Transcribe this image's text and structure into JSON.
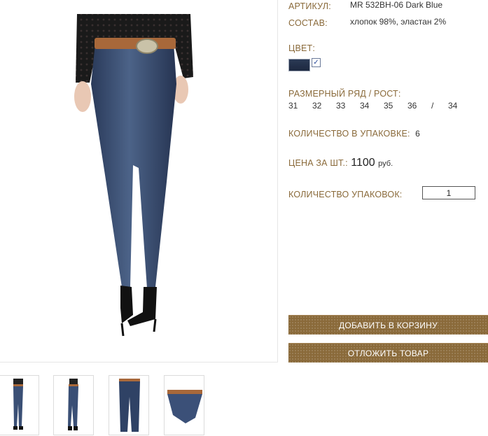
{
  "product": {
    "article_label": "АРТИКУЛ:",
    "article_value": "MR 532BH-06 Dark Blue",
    "composition_label": "СОСТАВ:",
    "composition_value": "хлопок 98%, эластан 2%",
    "color_label": "ЦВЕТ:",
    "swatch_check": "✓",
    "size_label": "РАЗМЕРНЫЙ РЯД / РОСТ:",
    "sizes": [
      "31",
      "32",
      "33",
      "34",
      "35",
      "36"
    ],
    "size_separator": "/",
    "height": "34",
    "pack_label": "КОЛИЧЕСТВО В УПАКОВКЕ:",
    "pack_value": "6",
    "price_label": "ЦЕНА ЗА ШТ.:",
    "price_value": "1100",
    "price_unit": "руб.",
    "qty_label": "КОЛИЧЕСТВО УПАКОВОК:",
    "qty_value": "1"
  },
  "actions": {
    "add_to_cart": "ДОБАВИТЬ В КОРЗИНУ",
    "save_item": "ОТЛОЖИТЬ ТОВАР"
  },
  "colors": {
    "label_brown": "#8a6a3a",
    "button_brown": "#8a6a3a",
    "denim": "#2b3a55"
  },
  "thumbnails": [
    "thumb-front",
    "thumb-side",
    "thumb-flat",
    "thumb-detail"
  ]
}
